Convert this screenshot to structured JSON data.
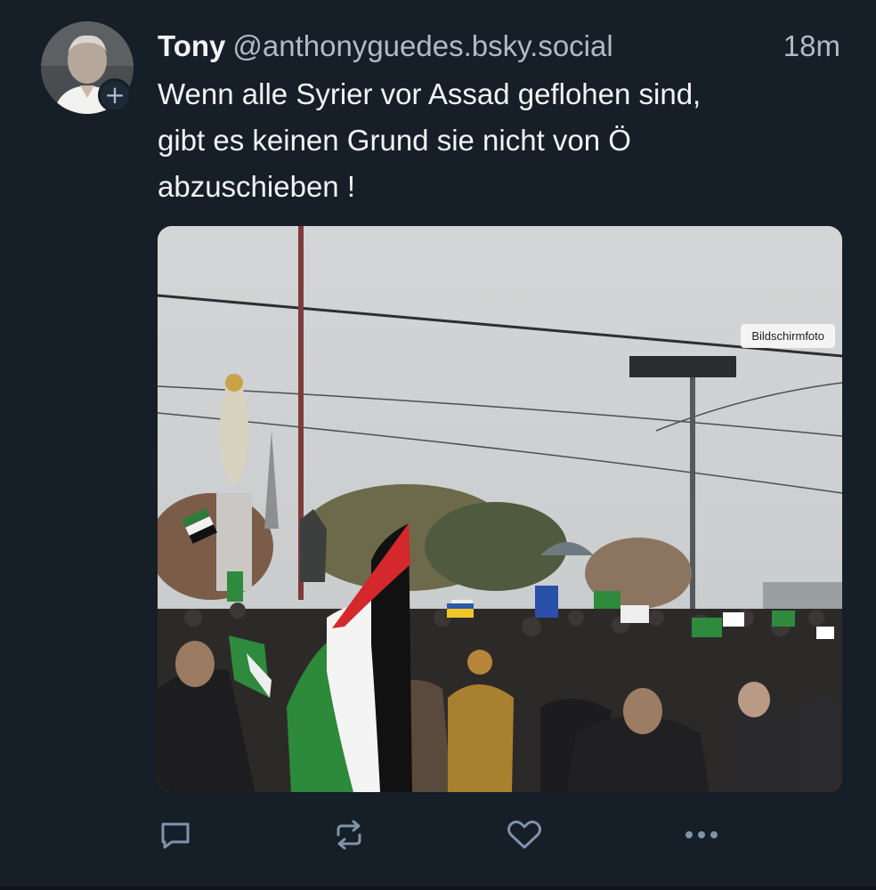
{
  "post": {
    "author_name": "Tony",
    "author_handle": "@anthonyguedes.bsky.social",
    "timestamp": "18m",
    "text_lines": [
      "Wenn alle Syrier vor Assad geflohen sind,",
      "gibt es keinen Grund sie nicht von Ö",
      "abzuschieben !"
    ],
    "image_badge": "Bildschirmfoto",
    "follow_symbol": "+"
  },
  "actions": [
    {
      "name": "reply-icon"
    },
    {
      "name": "repost-icon"
    },
    {
      "name": "like-icon"
    },
    {
      "name": "more-options-icon"
    }
  ],
  "colors": {
    "background": "#161e27",
    "text": "#f1f3f5",
    "muted": "#aebbc9",
    "icon": "#7f93aa"
  }
}
